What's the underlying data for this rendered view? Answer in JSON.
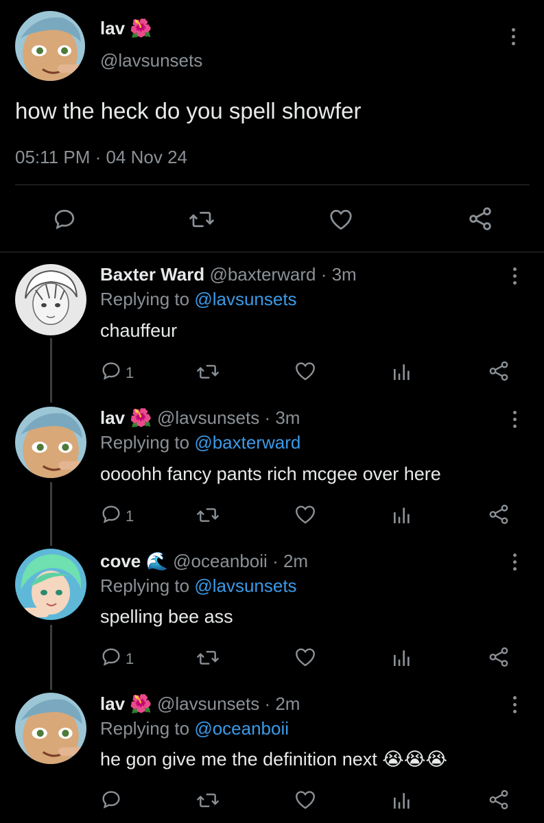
{
  "main_tweet": {
    "name": "lav",
    "emoji": "🌺",
    "handle": "@lavsunsets",
    "text": "how the heck do you spell showfer",
    "timestamp": "05:11 PM · 04 Nov 24"
  },
  "replies": [
    {
      "name": "Baxter Ward",
      "emoji": "",
      "handle": "@baxterward",
      "time": "· 3m",
      "replying_prefix": "Replying to",
      "replying_to": "@lavsunsets",
      "text": "chauffeur",
      "reply_count": "1"
    },
    {
      "name": "lav",
      "emoji": "🌺",
      "handle": "@lavsunsets",
      "time": "· 3m",
      "replying_prefix": "Replying to",
      "replying_to": "@baxterward",
      "text": "oooohh fancy pants rich mcgee over here",
      "reply_count": "1"
    },
    {
      "name": "cove",
      "emoji": "🌊",
      "handle": "@oceanboii",
      "time": "· 2m",
      "replying_prefix": "Replying to",
      "replying_to": "@lavsunsets",
      "text": "spelling bee ass",
      "reply_count": "1"
    },
    {
      "name": "lav",
      "emoji": "🌺",
      "handle": "@lavsunsets",
      "time": "· 2m",
      "replying_prefix": "Replying to",
      "replying_to": "@oceanboii",
      "text": "he gon give me the definition next 😭😭😭",
      "reply_count": ""
    }
  ],
  "icons": {
    "reply": "speech-bubble-icon",
    "retweet": "retweet-icon",
    "like": "heart-icon",
    "views": "bar-chart-icon",
    "share": "share-icon",
    "more": "more-vertical-icon"
  },
  "colors": {
    "background": "#000000",
    "text": "#e7e9ea",
    "muted": "#8b9196",
    "link": "#3b9ae8"
  }
}
